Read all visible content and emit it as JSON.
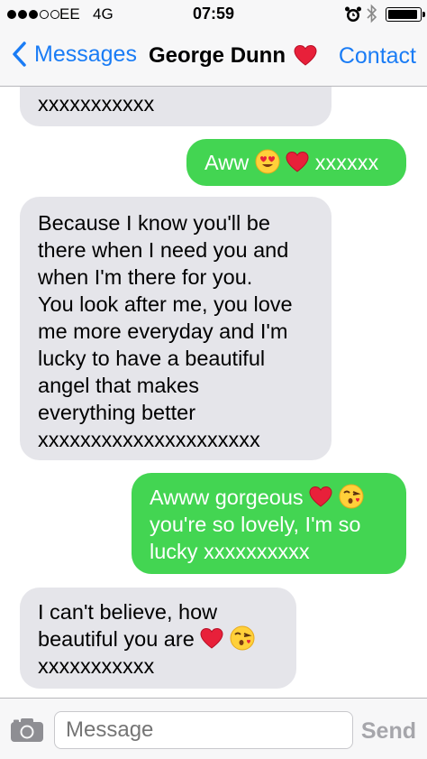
{
  "status_bar": {
    "carrier": "EE",
    "network": "4G",
    "time": "07:59",
    "signal_bars_filled": 3,
    "signal_bars_total": 5,
    "alarm_icon": "alarm-clock-icon",
    "bluetooth_icon": "bluetooth-icon",
    "battery_level": 0.95
  },
  "nav": {
    "back_label": "Messages",
    "title": "George Dunn",
    "title_icon": "red-heart-emoji",
    "contact_label": "Contact"
  },
  "messages": [
    {
      "sender": "them",
      "lines": [
        "xxxxxxxxxxx"
      ]
    },
    {
      "sender": "me",
      "lines": [
        "Aww",
        "xxxxxx"
      ],
      "emojis": [
        "heart-eyes-emoji",
        "red-heart-emoji"
      ]
    },
    {
      "sender": "them",
      "lines": [
        "Because I know you'll be",
        "there when I need you and",
        "when I'm there for you.",
        "You look after me, you love",
        "me more everyday and I'm",
        "lucky to have a beautiful",
        "angel that makes",
        "everything better",
        "xxxxxxxxxxxxxxxxxxxxx"
      ]
    },
    {
      "sender": "me",
      "lines": [
        "Awww gorgeous",
        "you're so lovely, I'm so",
        "lucky xxxxxxxxxx"
      ],
      "emojis": [
        "red-heart-emoji",
        "face-blowing-kiss-emoji"
      ]
    },
    {
      "sender": "them",
      "lines": [
        "I can't believe, how",
        "beautiful you are",
        "xxxxxxxxxxx"
      ],
      "emojis": [
        "red-heart-emoji",
        "face-blowing-kiss-emoji"
      ]
    }
  ],
  "input_bar": {
    "camera_icon": "camera-icon",
    "placeholder": "Message",
    "send_label": "Send"
  },
  "colors": {
    "incoming_bubble": "#e5e5ea",
    "outgoing_bubble": "#43d552",
    "accent": "#1a7cf5"
  }
}
